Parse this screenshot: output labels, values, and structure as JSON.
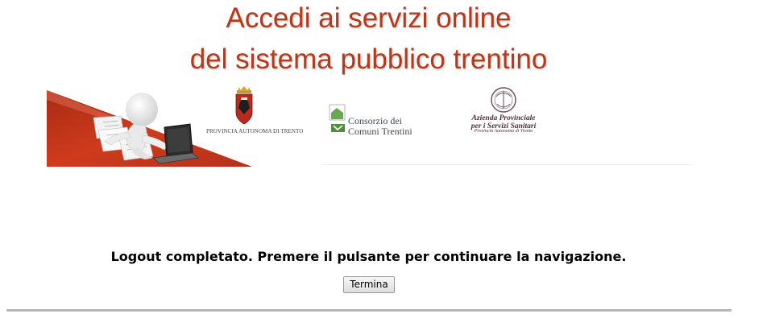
{
  "header": {
    "title_line1": "Accedi ai servizi online",
    "title_line2": "del sistema pubblico trentino"
  },
  "banner": {
    "logos": {
      "provincia": "PROVINCIA AUTONOMA DI TRENTO",
      "consorzio": "Consorzio dei\nComuni Trentini",
      "azienda": "Azienda Provinciale\nper i Servizi Sanitari",
      "azienda_sub": "Provincia Autonoma di Trento"
    }
  },
  "main": {
    "message": "Logout completato. Premere il pulsante per continuare la navigazione.",
    "button_label": "Termina"
  },
  "colors": {
    "title": "#b5391c",
    "banner_red": "#c2341a"
  }
}
